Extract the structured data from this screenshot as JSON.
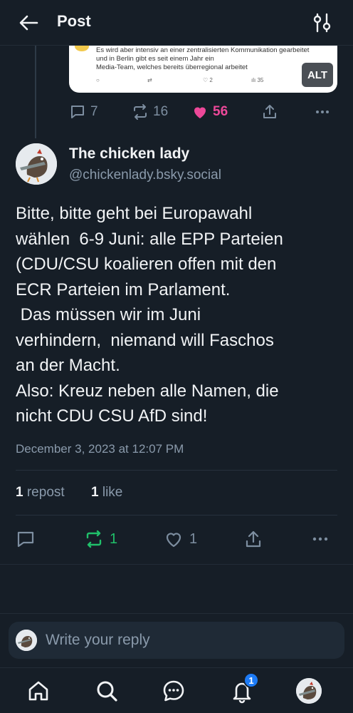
{
  "header": {
    "back_icon": "arrow-left-icon",
    "title": "Post",
    "settings_icon": "sliders-icon"
  },
  "quoted_embed": {
    "lines": [
      "Es wird aber intensiv an einer zentralisierten Kommunikation gearbeitet",
      "und in Berlin gibt es seit einem Jahr ein",
      "Media-Team, welches bereits überregional arbeitet"
    ],
    "mini_like_count": "2",
    "mini_views_count": "35",
    "alt_label": "ALT"
  },
  "parent_actions": {
    "replies": "7",
    "reposts": "16",
    "likes": "56",
    "like_color": "#ec4899"
  },
  "post": {
    "author_name": "The chicken lady",
    "author_handle": "@chickenlady.bsky.social",
    "text": "Bitte, bitte geht bei Europawahl\nwählen  6-9 Juni: alle EPP Parteien\n(CDU/CSU koalieren offen mit den\nECR Parteien im Parlament.\n Das müssen wir im Juni\nverhindern,  niemand will Faschos\nan der Macht.\nAlso: Kreuz neben alle Namen, die\nnicht CDU CSU AfD sind!",
    "date": "December 3, 2023 at 12:07 PM",
    "repost_count": "1",
    "repost_label": "repost",
    "like_count": "1",
    "like_label": "like"
  },
  "post_actions": {
    "reposts": "1",
    "likes": "1",
    "repost_color": "#20c06a"
  },
  "reply": {
    "placeholder": "Write your reply"
  },
  "bottom_nav": {
    "notification_badge": "1"
  }
}
